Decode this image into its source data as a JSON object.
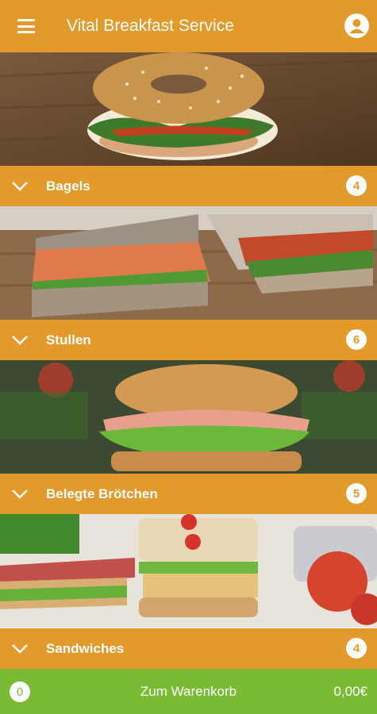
{
  "app": {
    "title": "Vital Breakfast Service",
    "accent_color": "#e49a2a",
    "cart_color": "#79bb35",
    "menu_icon": "hamburger-menu-icon",
    "profile_icon": "user-profile-icon"
  },
  "categories": [
    {
      "name": "Bagels",
      "count": "4",
      "photo": "bagel-sandwich-photo"
    },
    {
      "name": "Stullen",
      "count": "6",
      "photo": "bread-sandwich-photo"
    },
    {
      "name": "Belegte Brötchen",
      "count": "5",
      "photo": "filled-roll-photo"
    },
    {
      "name": "Sandwiches",
      "count": "4",
      "photo": "club-sandwich-photo"
    }
  ],
  "cart": {
    "count": "0",
    "label": "Zum Warenkorb",
    "total": "0,00€"
  }
}
